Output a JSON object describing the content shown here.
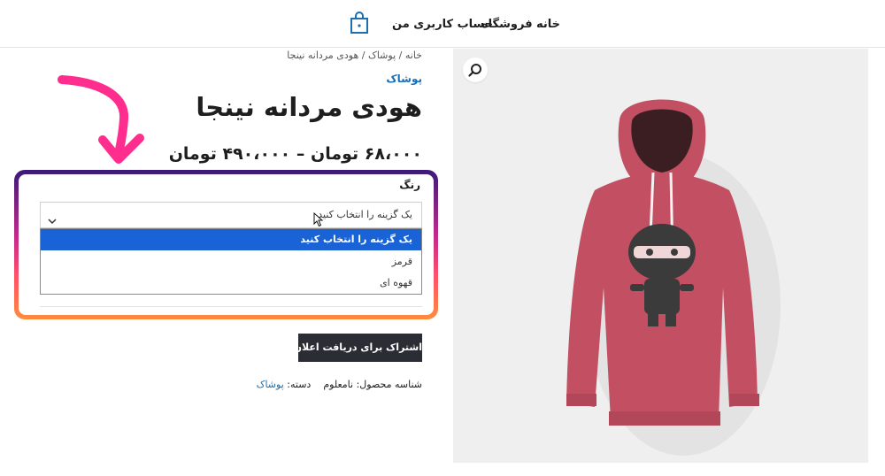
{
  "header": {
    "nav": [
      "خانه",
      "فروشگاه",
      "حساب کاربری من"
    ],
    "cart_icon": "shopping-bag-icon"
  },
  "breadcrumb": [
    "خانه",
    "پوشاک",
    "هودی مردانه نینجا"
  ],
  "breadcrumb_separator": "/",
  "product": {
    "category": "پوشاک",
    "title": "هودی مردانه نینجا",
    "price": "۶۸،۰۰۰ تومان – ۴۹۰،۰۰۰ تومان"
  },
  "variation": {
    "label": "رنگ",
    "selected": "یک گزینه را انتخاب کنید",
    "options": [
      "یک گزینه را انتخاب کنید",
      "قرمز",
      "قهوه ای"
    ]
  },
  "notify_button": "اشتراک برای دریافت اعلان",
  "meta": {
    "sku_label": "شناسه محصول:",
    "sku_value": "نامعلوم",
    "category_label": "دسته:",
    "category_value": "پوشاک"
  },
  "zoom_icon": "magnifier-icon",
  "colors": {
    "link": "#1a6fb5",
    "button": "#2a2d33",
    "option_highlight": "#1a63d6",
    "frame_gradient": [
      "#3b1a7a",
      "#c42a8a",
      "#ff4f6a",
      "#ff8c3c"
    ],
    "arrow": "#ff2d8e"
  }
}
